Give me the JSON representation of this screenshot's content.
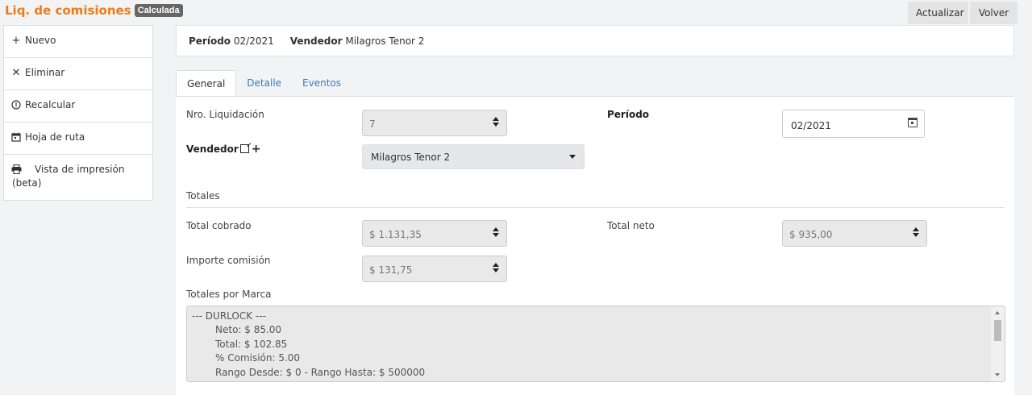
{
  "header": {
    "title": "Liq. de comisiones",
    "status_badge": "Calculada",
    "refresh_label": "Actualizar",
    "back_label": "Volver"
  },
  "sidebar": {
    "items": [
      {
        "label": "Nuevo",
        "icon": "plus-icon"
      },
      {
        "label": "Eliminar",
        "icon": "close-icon"
      },
      {
        "label": "Recalcular",
        "icon": "alert-circle-icon"
      },
      {
        "label": "Hoja de ruta",
        "icon": "calendar-icon"
      },
      {
        "label": "Vista de impresión (beta)",
        "icon": "print-icon"
      }
    ]
  },
  "summary": {
    "period_label": "Período",
    "period_value": "02/2021",
    "seller_label": "Vendedor",
    "seller_value": "Milagros Tenor 2"
  },
  "tabs": [
    {
      "label": "General",
      "active": true
    },
    {
      "label": "Detalle",
      "active": false
    },
    {
      "label": "Eventos",
      "active": false
    }
  ],
  "form": {
    "nro_label": "Nro. Liquidación",
    "nro_value": "7",
    "periodo_label": "Período",
    "periodo_value": "02/2021",
    "vendedor_label": "Vendedor",
    "vendedor_value": "Milagros Tenor 2",
    "totales_label": "Totales",
    "total_cobrado_label": "Total cobrado",
    "total_cobrado_value": "$ 1.131,35",
    "total_neto_label": "Total neto",
    "total_neto_value": "$ 935,00",
    "importe_comision_label": "Importe comisión",
    "importe_comision_value": "$ 131,75",
    "totales_marca_label": "Totales por Marca",
    "totales_marca_lines": {
      "l0": "--- DURLOCK ---",
      "l1": "Neto: $ 85.00",
      "l2": "Total: $ 102.85",
      "l3": "% Comisión: 5.00",
      "l4": "Rango Desde: $ 0 - Rango Hasta: $ 500000"
    }
  },
  "colors": {
    "title": "#f07b13",
    "link": "#2f7fcf",
    "badge": "#666666"
  }
}
